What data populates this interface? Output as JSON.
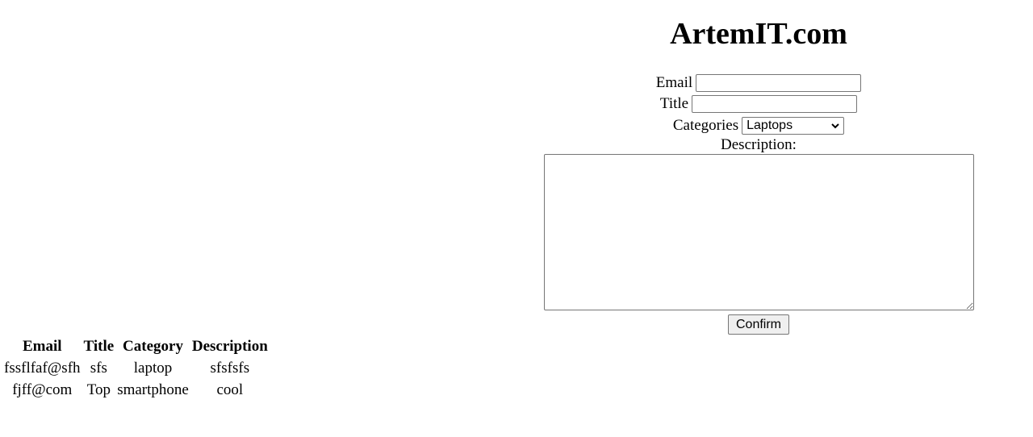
{
  "header": {
    "title": "ArtemIT.com"
  },
  "form": {
    "email_label": "Email",
    "email_value": "",
    "title_label": "Title",
    "title_value": "",
    "categories_label": "Categories",
    "categories_selected": "Laptops",
    "description_label": "Description:",
    "description_value": "",
    "confirm_label": "Confirm"
  },
  "table": {
    "headers": [
      "Email",
      "Title",
      "Category",
      "Description"
    ],
    "rows": [
      [
        "fssflfaf@sfh",
        "sfs",
        "laptop",
        "sfsfsfs"
      ],
      [
        "fjff@com",
        "Top",
        "smartphone",
        "cool"
      ]
    ]
  }
}
